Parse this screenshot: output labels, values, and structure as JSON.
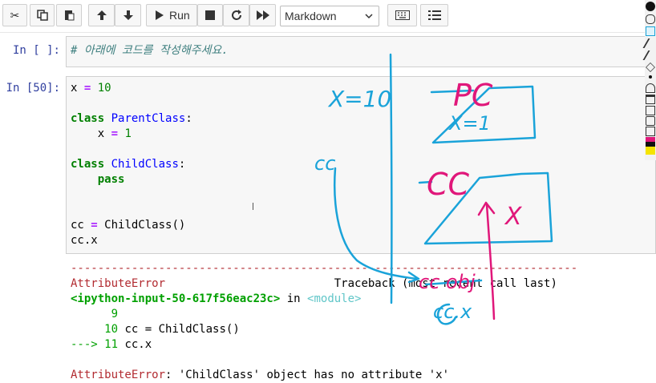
{
  "toolbar": {
    "run_label": "Run",
    "cell_type": "Markdown",
    "icons": [
      "scissors-icon",
      "copy-icon",
      "paste-icon",
      "arrow-up-icon",
      "arrow-down-icon",
      "run-icon",
      "stop-icon",
      "restart-icon",
      "fast-forward-icon",
      "keyboard-icon",
      "list-icon"
    ]
  },
  "cells": [
    {
      "prompt": "In [ ]:",
      "lines": [
        "# 아래에 코드를 작성해주세요."
      ]
    },
    {
      "prompt": "In [50]:",
      "lines": [
        "x = 10",
        "",
        "class ParentClass:",
        "    x = 1",
        "",
        "class ChildClass:",
        "    pass",
        "",
        "",
        "cc = ChildClass()",
        "cc.x"
      ]
    }
  ],
  "output": {
    "dashes": "---------------------------------------------------------------------------",
    "error_name": "AttributeError",
    "traceback_label": "Traceback (most recent call last)",
    "input_ref": "<ipython-input-50-617f56eac23c>",
    "in_word": "in",
    "module": "<module>",
    "line9": "      9",
    "line10_num": "     10",
    "line10_code": "cc = ChildClass()",
    "arrow": "---> 11",
    "line11_code": "cc.x",
    "final_error": "AttributeError",
    "final_message": ": 'ChildClass' object has no attribute 'x'"
  },
  "annotations": {
    "x_eq_10": "X=10",
    "pc": "PC",
    "pc_x": "X=1",
    "cc_label": "cc",
    "cc_box": "CC",
    "cc_x": "X",
    "cc_obj": "cc obj",
    "cc_dot_x": "cc.x"
  },
  "colors": {
    "ink_blue": "#1aa3d9",
    "ink_magenta": "#e0177a",
    "prompt_blue": "#303f9f"
  }
}
